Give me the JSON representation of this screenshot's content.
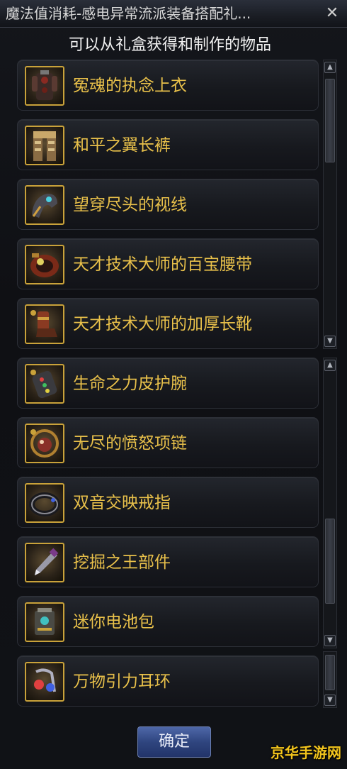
{
  "window": {
    "title": "魔法值消耗-感电异常流派装备搭配礼...",
    "close_glyph": "✕"
  },
  "header": {
    "subtitle": "可以从礼盒获得和制作的物品"
  },
  "items": [
    {
      "label": "冤魂的执念上衣",
      "icon": "armor-chest-icon"
    },
    {
      "label": "和平之翼长裤",
      "icon": "armor-pants-icon"
    },
    {
      "label": "望穿尽头的视线",
      "icon": "armor-shoulder-icon"
    },
    {
      "label": "天才技术大师的百宝腰带",
      "icon": "belt-icon"
    },
    {
      "label": "天才技术大师的加厚长靴",
      "icon": "boots-icon"
    },
    {
      "label": "生命之力皮护腕",
      "icon": "bracer-icon"
    },
    {
      "label": "无尽的愤怒项链",
      "icon": "necklace-icon"
    },
    {
      "label": "双音交映戒指",
      "icon": "ring-icon"
    },
    {
      "label": "挖掘之王部件",
      "icon": "drill-part-icon"
    },
    {
      "label": "迷你电池包",
      "icon": "battery-pack-icon"
    },
    {
      "label": "万物引力耳环",
      "icon": "earring-icon"
    }
  ],
  "footer": {
    "ok_label": "确定"
  },
  "watermark": "京华手游网",
  "colors": {
    "item_text": "#e8c04a",
    "icon_frame": "#c9a23a",
    "ok_button": "#2f457f"
  }
}
